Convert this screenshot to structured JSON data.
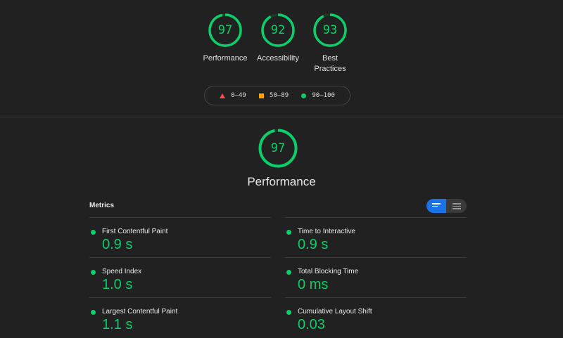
{
  "summary_gauges": [
    {
      "score": "97",
      "label_line1": "Performance",
      "label_line2": ""
    },
    {
      "score": "92",
      "label_line1": "Accessibility",
      "label_line2": ""
    },
    {
      "score": "93",
      "label_line1": "Best",
      "label_line2": "Practices"
    }
  ],
  "legend": {
    "fail": "0–49",
    "average": "50–89",
    "pass": "90–100"
  },
  "main": {
    "score": "97",
    "title": "Performance"
  },
  "metrics": {
    "header": "Metrics",
    "items": [
      {
        "name": "First Contentful Paint",
        "value": "0.9 s"
      },
      {
        "name": "Time to Interactive",
        "value": "0.9 s"
      },
      {
        "name": "Speed Index",
        "value": "1.0 s"
      },
      {
        "name": "Total Blocking Time",
        "value": "0 ms"
      },
      {
        "name": "Largest Contentful Paint",
        "value": "1.1 s"
      },
      {
        "name": "Cumulative Layout Shift",
        "value": "0.03"
      }
    ]
  },
  "colors": {
    "pass": "#0cce6b",
    "average": "#ffa400",
    "fail": "#ff4e42",
    "toggle_active": "#1a73e8"
  }
}
